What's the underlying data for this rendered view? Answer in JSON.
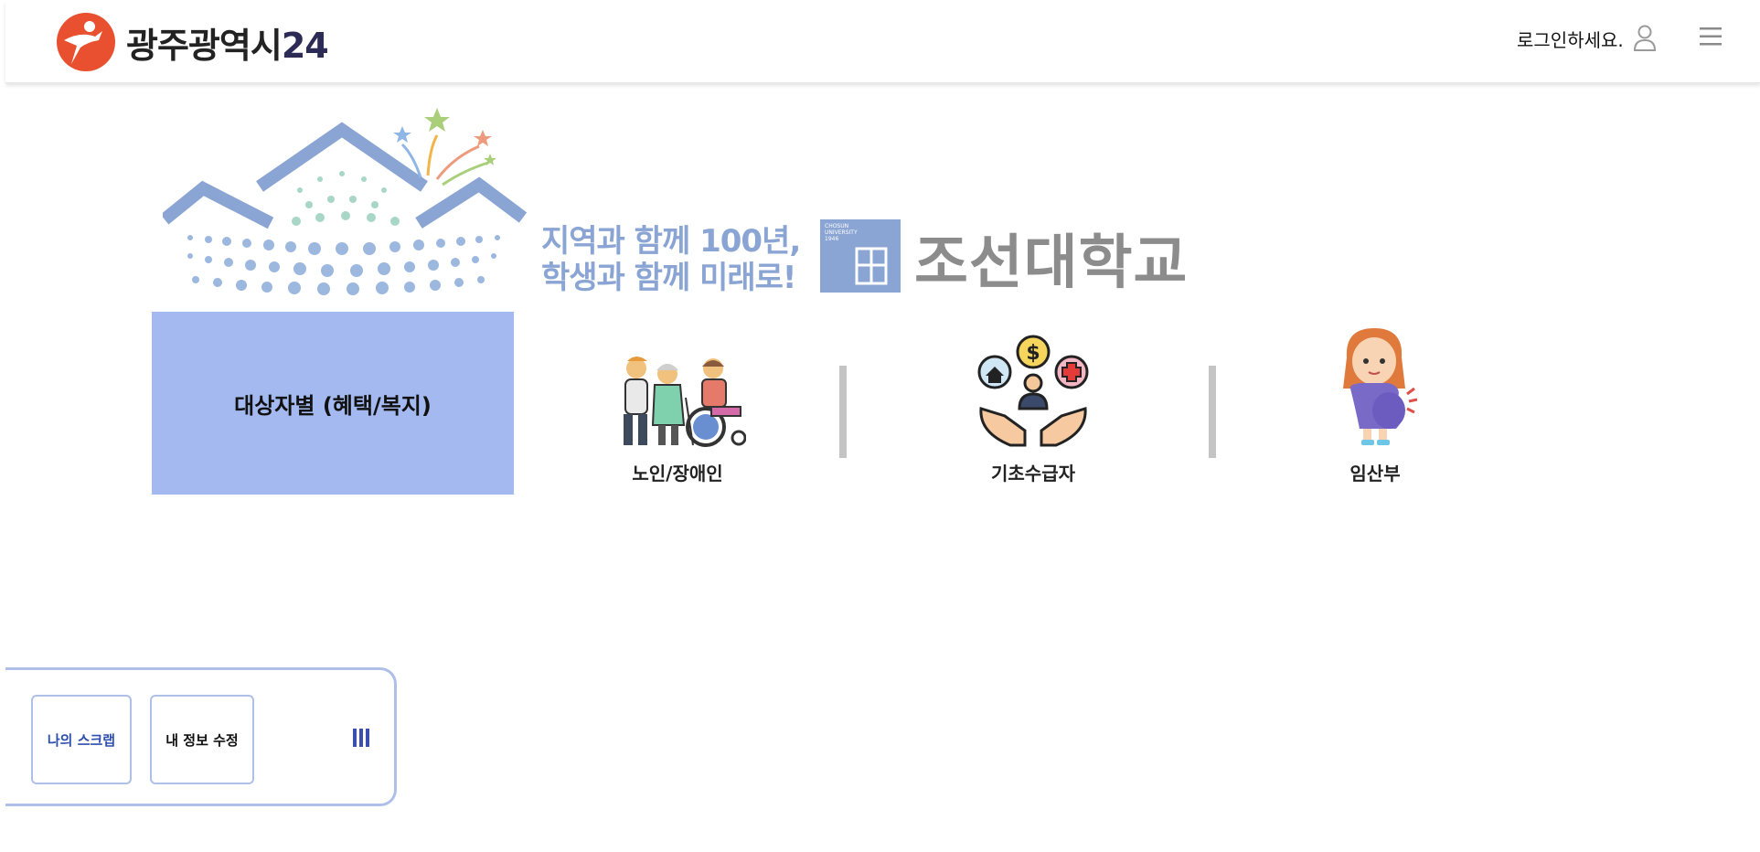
{
  "header": {
    "logo_text": "광주광역시",
    "logo_num": "24",
    "login_text": "로그인하세요.",
    "icons": {
      "user": "user-icon",
      "menu": "hamburger-menu-icon"
    }
  },
  "banner": {
    "line1": "지역과 함께 100년,",
    "line2": "학생과 함께 미래로!",
    "univ_small": "CHOSUN UNIVERSITY 1946",
    "univ_name": "조선대학교"
  },
  "categories": {
    "active_label": "대상자별 (혜택/복지)",
    "items": [
      {
        "label": "노인/장애인",
        "icon": "elderly-disabled-icon"
      },
      {
        "label": "기초수급자",
        "icon": "welfare-support-icon"
      },
      {
        "label": "임산부",
        "icon": "pregnant-woman-icon"
      }
    ]
  },
  "quick_panel": {
    "scrap_label": "나의 스크랩",
    "edit_label": "내 정보 수정",
    "toggle_icon": "panel-toggle-icon"
  },
  "colors": {
    "brand_orange": "#e8502f",
    "active_tab": "#a3b9f0",
    "panel_border": "#aebfe8",
    "banner_blue": "#8aa5d3"
  }
}
